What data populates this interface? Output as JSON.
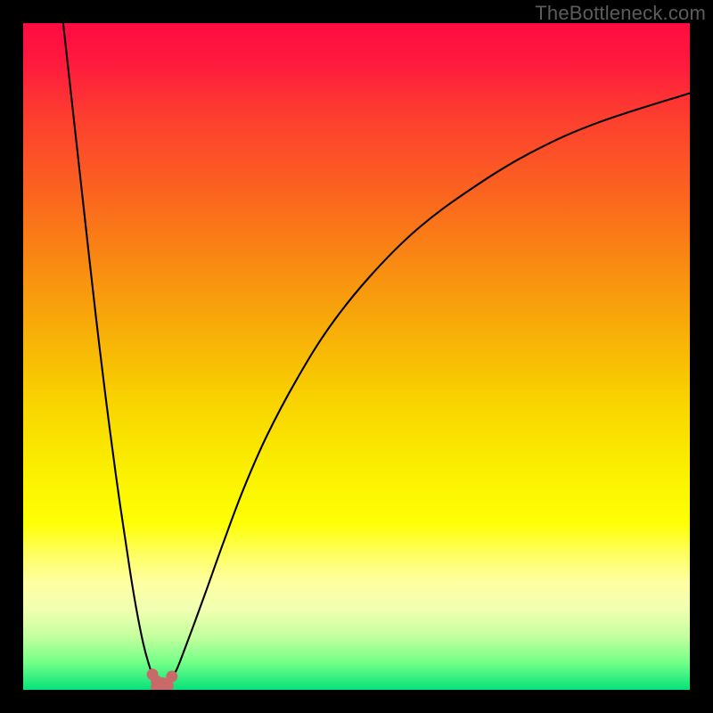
{
  "watermark": "TheBottleneck.com",
  "chart_data": {
    "type": "line",
    "title": "",
    "xlabel": "",
    "ylabel": "",
    "xlim": [
      0,
      100
    ],
    "ylim": [
      0,
      100
    ],
    "gradient_stops": [
      {
        "offset": 0.0,
        "color": "#ff0b43"
      },
      {
        "offset": 0.06,
        "color": "#ff1a3e"
      },
      {
        "offset": 0.14,
        "color": "#fd3e2f"
      },
      {
        "offset": 0.24,
        "color": "#fb5f21"
      },
      {
        "offset": 0.36,
        "color": "#f98a12"
      },
      {
        "offset": 0.48,
        "color": "#f8b506"
      },
      {
        "offset": 0.58,
        "color": "#f9d700"
      },
      {
        "offset": 0.68,
        "color": "#fbf200"
      },
      {
        "offset": 0.75,
        "color": "#feff05"
      },
      {
        "offset": 0.8,
        "color": "#feff67"
      },
      {
        "offset": 0.84,
        "color": "#feffa3"
      },
      {
        "offset": 0.88,
        "color": "#f0ffb1"
      },
      {
        "offset": 0.92,
        "color": "#c4ff9e"
      },
      {
        "offset": 0.96,
        "color": "#71ff88"
      },
      {
        "offset": 1.0,
        "color": "#05e27a"
      }
    ],
    "series": [
      {
        "name": "left-branch",
        "x": [
          6.0,
          8.0,
          10.0,
          11.5,
          13.0,
          14.5,
          16.0,
          17.0,
          18.0,
          18.8,
          19.4,
          20.0
        ],
        "y": [
          100.0,
          82.0,
          64.0,
          51.0,
          39.0,
          28.0,
          18.0,
          12.0,
          7.0,
          4.0,
          2.3,
          1.3
        ]
      },
      {
        "name": "right-branch",
        "x": [
          22.0,
          23.0,
          24.0,
          25.5,
          27.5,
          30.0,
          33.0,
          36.5,
          41.0,
          46.0,
          52.0,
          59.0,
          67.0,
          76.0,
          86.0,
          100.0
        ],
        "y": [
          1.3,
          3.0,
          5.5,
          9.5,
          15.0,
          22.0,
          30.0,
          38.0,
          46.5,
          54.5,
          62.0,
          69.0,
          75.0,
          80.5,
          85.0,
          89.5
        ]
      }
    ],
    "valley_points": {
      "x": [
        19.4,
        20.0,
        20.0,
        21.0,
        21.0,
        21.7,
        22.3
      ],
      "y": [
        2.3,
        1.3,
        0.4,
        0.2,
        1.0,
        0.6,
        2.0
      ]
    },
    "valley_dot_color": "#c86a6a",
    "valley_dot_radius": 6.5,
    "curve_stroke": "#000000",
    "curve_width": 2.1
  }
}
